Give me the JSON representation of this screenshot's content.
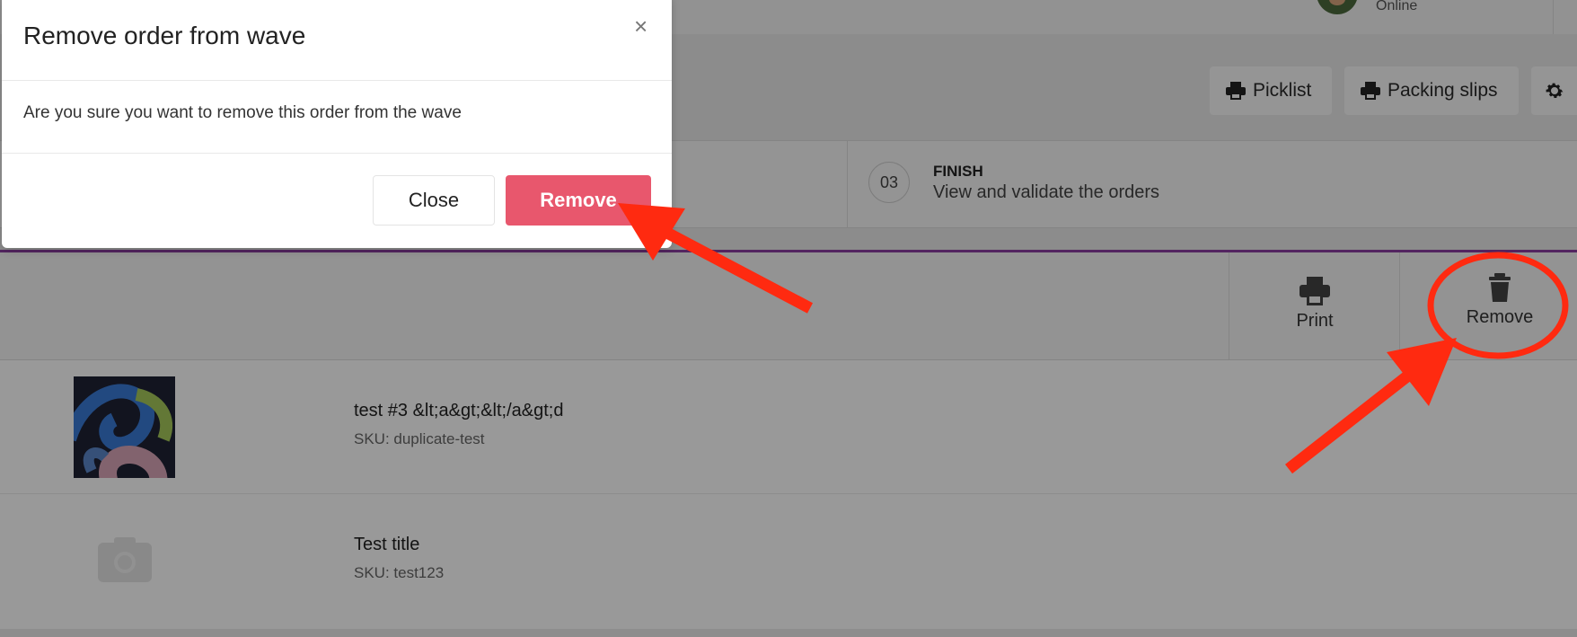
{
  "header": {
    "user_status": "Online"
  },
  "toolbar": {
    "picklist_label": "Picklist",
    "packing_slips_label": "Packing slips"
  },
  "steps": {
    "active": {
      "number": "03",
      "title": "FINISH",
      "description": "View and validate the orders"
    }
  },
  "order_actions": {
    "print_label": "Print",
    "remove_label": "Remove"
  },
  "items": [
    {
      "title": "test #3 &lt;a&gt;&lt;/a&gt;d",
      "sku": "SKU: duplicate-test"
    },
    {
      "title": "Test title",
      "sku": "SKU: test123"
    }
  ],
  "modal": {
    "title": "Remove order from wave",
    "close_icon": "×",
    "message": "Are you sure you want to remove this order from the wave",
    "close_label": "Close",
    "remove_label": "Remove"
  },
  "colors": {
    "remove_button": "#e8576d",
    "annotation": "#ff2a10",
    "accent_line": "#8a3ea0"
  }
}
